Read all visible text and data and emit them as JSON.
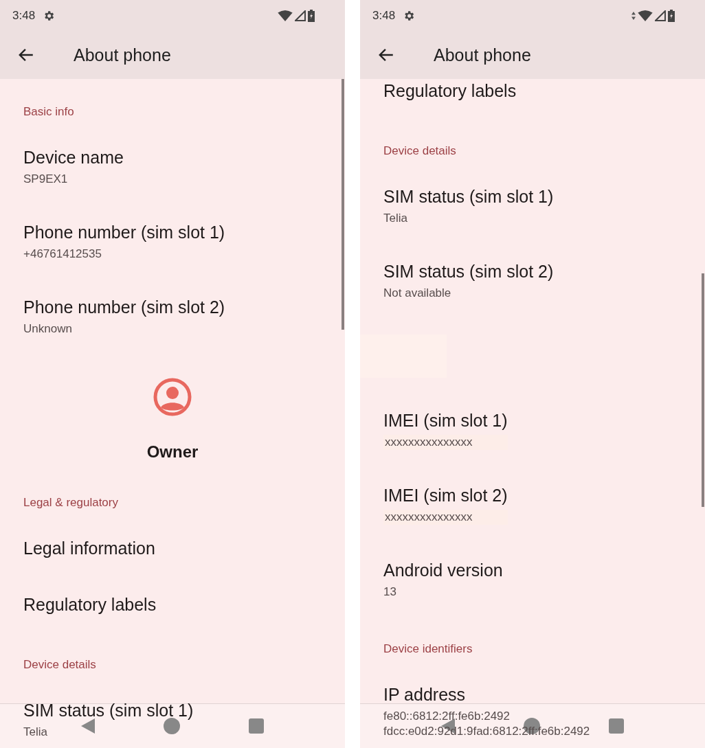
{
  "phones": [
    {
      "status_bar": {
        "time": "3:48",
        "data_activity": false
      },
      "app_bar": {
        "title": "About phone"
      },
      "items": [
        {
          "kind": "header",
          "title": "Basic info"
        },
        {
          "kind": "item",
          "title": "Device name",
          "summary": "SP9EX1"
        },
        {
          "kind": "item",
          "title": "Phone number (sim slot 1)",
          "summary": "+46761412535"
        },
        {
          "kind": "item",
          "title": "Phone number (sim slot 2)",
          "summary": "Unknown"
        },
        {
          "kind": "owner",
          "title": "Owner"
        },
        {
          "kind": "header",
          "title": "Legal & regulatory"
        },
        {
          "kind": "item",
          "title": "Legal information"
        },
        {
          "kind": "item",
          "title": "Regulatory labels"
        },
        {
          "kind": "header",
          "title": "Device details"
        },
        {
          "kind": "item",
          "title": "SIM status (sim slot 1)",
          "summary": "Telia"
        }
      ]
    },
    {
      "status_bar": {
        "time": "3:48",
        "data_activity": true
      },
      "app_bar": {
        "title": "About phone"
      },
      "items": [
        {
          "kind": "item",
          "title": "Regulatory labels"
        },
        {
          "kind": "header",
          "title": "Device details"
        },
        {
          "kind": "item",
          "title": "SIM status (sim slot 1)",
          "summary": "Telia"
        },
        {
          "kind": "item",
          "title": "SIM status (sim slot 2)",
          "summary": "Not available"
        },
        {
          "kind": "redacted"
        },
        {
          "kind": "item",
          "title": "IMEI (sim slot 1)",
          "summary": "xxxxxxxxxxxxxxx",
          "masked": true
        },
        {
          "kind": "item",
          "title": "IMEI (sim slot 2)",
          "summary": "xxxxxxxxxxxxxxx",
          "masked": true
        },
        {
          "kind": "item",
          "title": "Android version",
          "summary": "13"
        },
        {
          "kind": "header",
          "title": "Device identifiers"
        },
        {
          "kind": "item",
          "title": "IP address",
          "summary": "fe80::6812:2ff:fe6b:2492\nfdcc:e0d2:92d1:9fad:6812:2ff:fe6b:2492"
        }
      ]
    }
  ]
}
